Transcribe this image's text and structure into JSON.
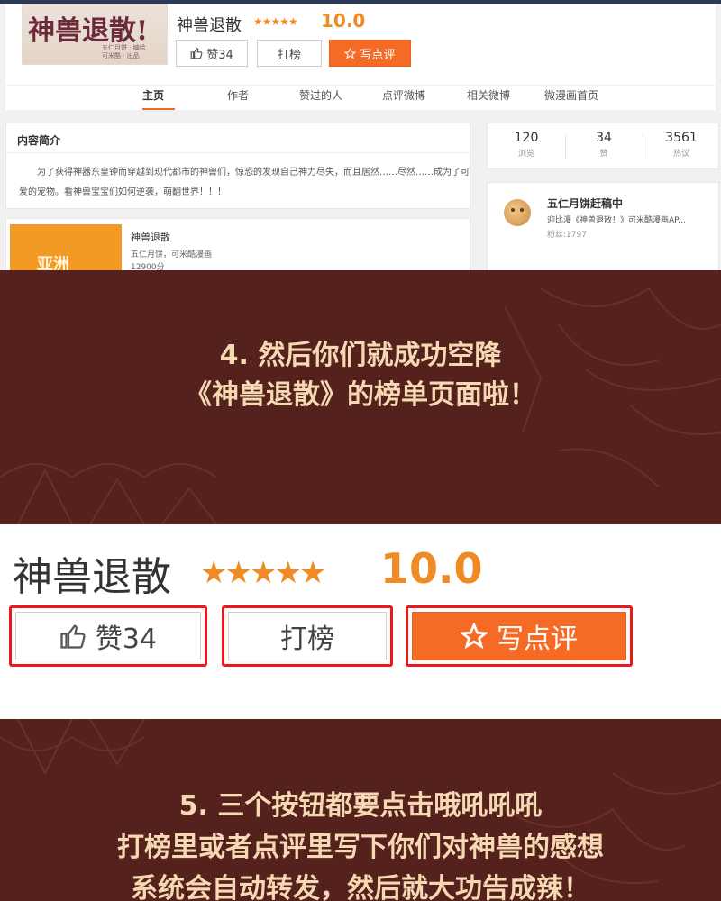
{
  "webpage": {
    "cover": {
      "title": "神兽退散!",
      "subtitle_lines": [
        "五仁月饼 · 编绘",
        "可米酷 · 出品"
      ]
    },
    "title": "神兽退散",
    "stars": "★★★★★",
    "score": "10.0",
    "buttons": {
      "like": "赞34",
      "rank": "打榜",
      "review": "写点评"
    },
    "nav": [
      "主页",
      "作者",
      "赞过的人",
      "点评微博",
      "相关微博",
      "微漫画首页"
    ],
    "intro": {
      "heading": "内容简介",
      "text": "为了获得神器东皇钟而穿越到现代都市的神兽们，惊恐的发现自己神力尽失，而且居然……尽然……成为了可爱的宠物。看神兽宝宝们如何逆袭，萌翻世界！！！"
    },
    "book": {
      "cover_text": "亚洲",
      "title": "神兽退散",
      "author": "五仁月饼，可米酷漫画",
      "score": "12900分"
    },
    "stats": [
      {
        "value": "120",
        "label": "浏览"
      },
      {
        "value": "34",
        "label": "赞"
      },
      {
        "value": "3561",
        "label": "热议"
      }
    ],
    "user": {
      "name": "五仁月饼赶稿中",
      "desc": "迎比漫《神兽退散！》可米酷漫画AP...",
      "fans": "粉丝:1797"
    }
  },
  "caption1": {
    "line1": "4. 然后你们就成功空降",
    "line2": "《神兽退散》的榜单页面啦！"
  },
  "zoom": {
    "title": "神兽退散",
    "stars": "★★★★★",
    "score": "10.0",
    "buttons": {
      "like": "赞34",
      "rank": "打榜",
      "review": "写点评"
    }
  },
  "caption2": {
    "line1": "5. 三个按钮都要点击哦吼吼吼",
    "line2": "打榜里或者点评里写下你们对神兽的感想",
    "line3": "系统会自动转发，然后就大功告成辣！"
  },
  "colors": {
    "accent_orange": "#f56a24",
    "score_orange": "#f08a24",
    "panel_brown": "#55211c",
    "caption_text": "#f6d9b3",
    "highlight_red": "#e8191f"
  }
}
